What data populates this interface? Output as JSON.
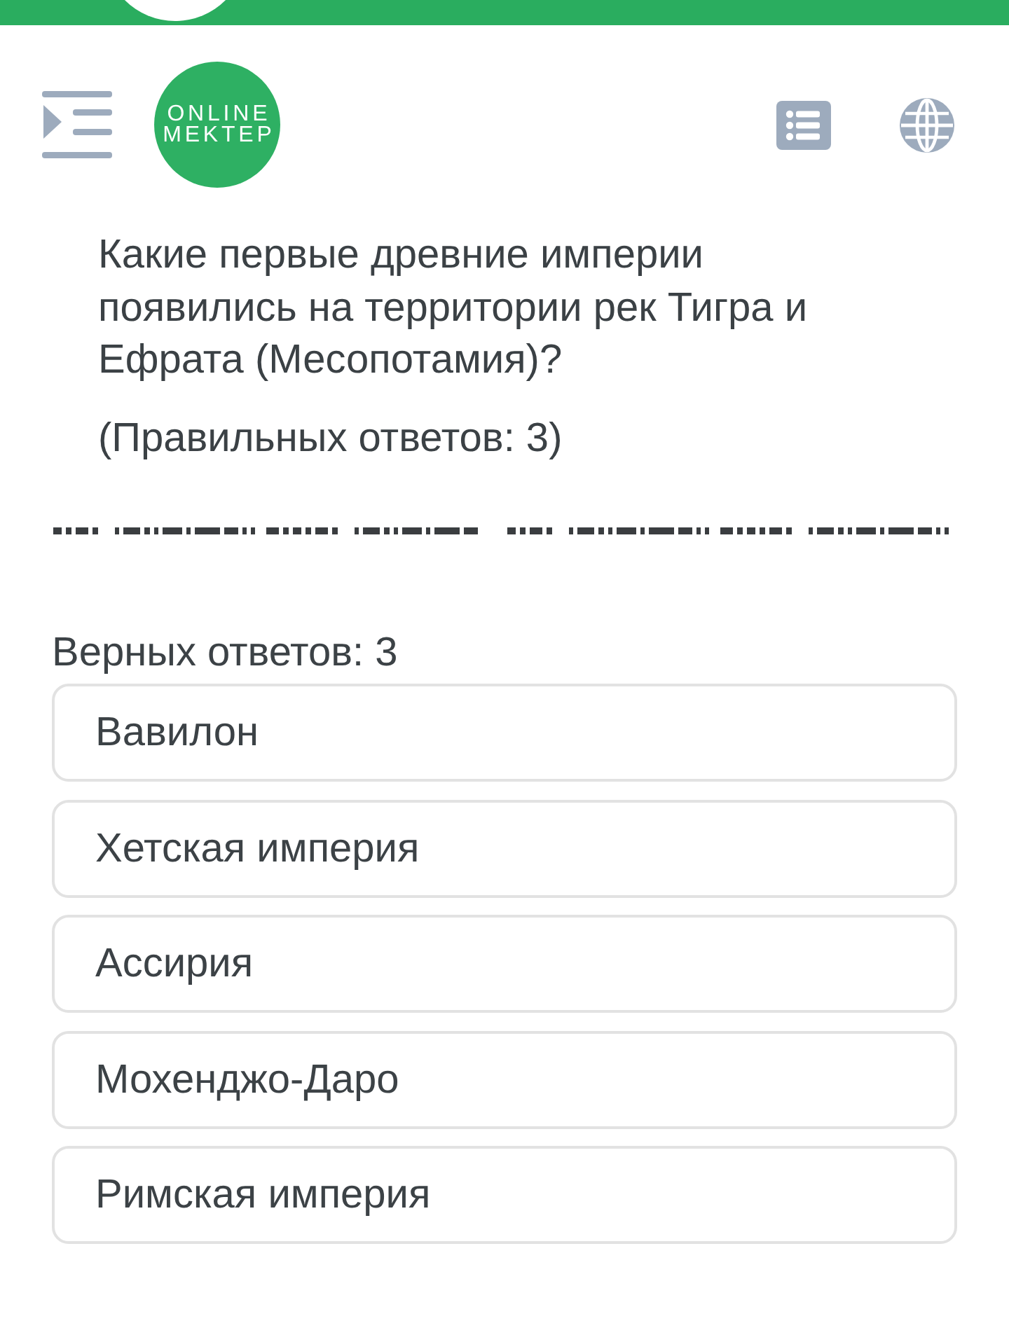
{
  "header": {
    "logo": {
      "lines": [
        "ONLINE",
        "MEKTEP"
      ]
    }
  },
  "question": {
    "text": "Какие первые древние империи появились на территории рек Тигра и Ефрата (Месопотамия)?",
    "hint": "(Правильных ответов: 3)"
  },
  "answers": {
    "label": "Верных ответов: 3",
    "options": [
      {
        "text": "Вавилон",
        "selected": false
      },
      {
        "text": "Хетская империя",
        "selected": false
      },
      {
        "text": "Ассирия",
        "selected": false
      },
      {
        "text": "Мохенджо-Даро",
        "selected": false
      },
      {
        "text": "Римская империя",
        "selected": false
      }
    ]
  }
}
